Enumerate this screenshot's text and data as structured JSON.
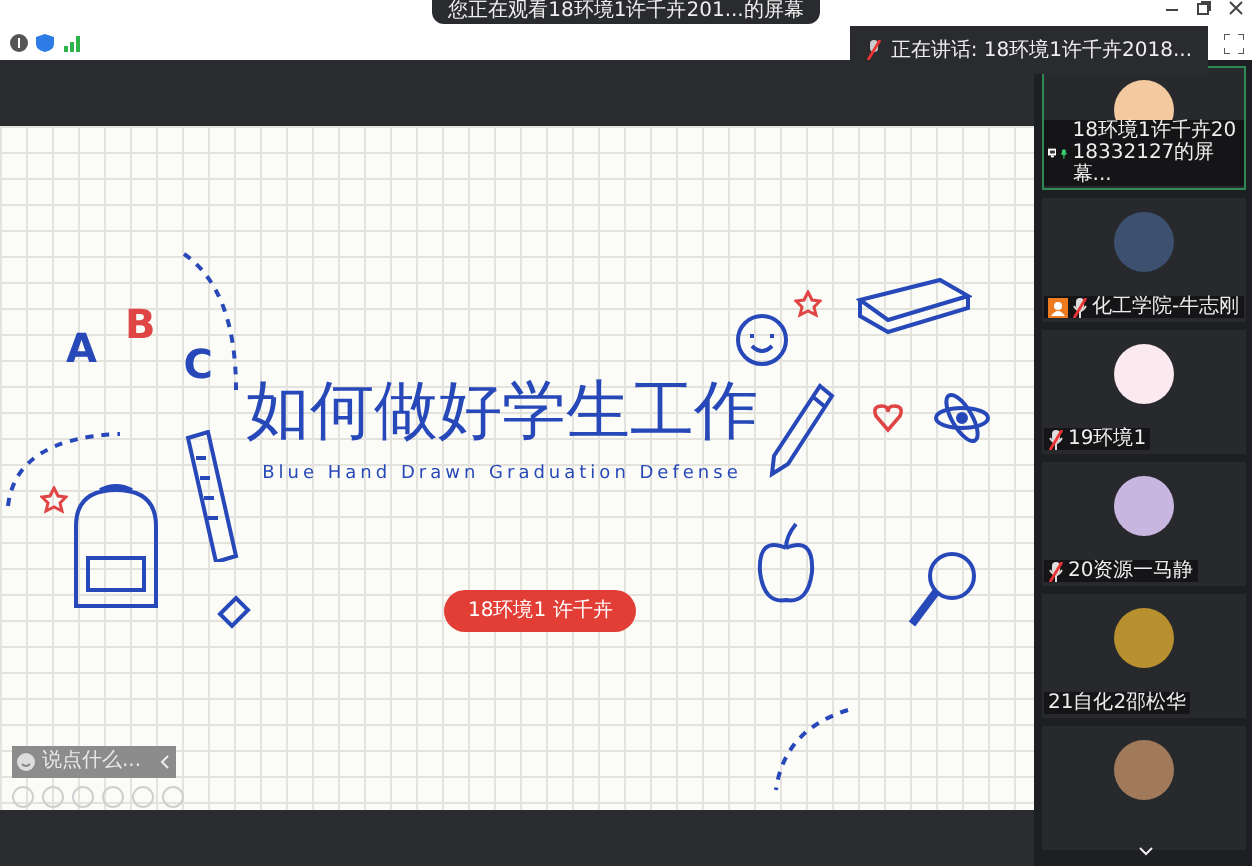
{
  "banner": {
    "title": "您正在观看18环境1许千卉201...的屏幕"
  },
  "speaking": {
    "text": "正在讲话: 18环境1许千卉2018..."
  },
  "slide": {
    "letters": [
      "A",
      "B",
      "C"
    ],
    "title": "如何做好学生工作",
    "subtitle": "Blue Hand Drawn Graduation Defense",
    "presenter": "18环境1 许千卉"
  },
  "chat": {
    "placeholder": "说点什么..."
  },
  "participants": [
    {
      "name": "18环境1许千卉2018332127的屏幕...",
      "muted": false,
      "sharing": true,
      "video_off": false,
      "speaking": true
    },
    {
      "name": "化工学院-牛志刚",
      "muted": true,
      "sharing": false,
      "video_off": true,
      "speaking": false
    },
    {
      "name": "19环境1",
      "muted": true,
      "sharing": false,
      "video_off": false,
      "speaking": false
    },
    {
      "name": "20资源一马静",
      "muted": true,
      "sharing": false,
      "video_off": false,
      "speaking": false
    },
    {
      "name": "21自化2邵松华",
      "sharing": false,
      "video_off": false,
      "speaking": false
    },
    {
      "sharing": false,
      "video_off": false,
      "speaking": false
    }
  ]
}
